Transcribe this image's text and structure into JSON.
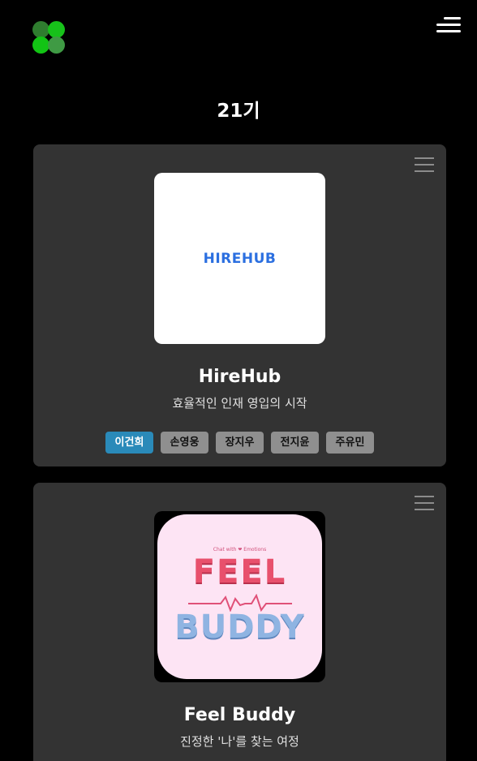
{
  "header": {
    "logo_icon": "clover-logo-icon",
    "menu_icon": "hamburger-menu-icon"
  },
  "page_title": "21기",
  "projects": [
    {
      "name": "HireHub",
      "thumbnail_text": "HIREHUB",
      "description": "효율적인 인재 영입의 시작",
      "members": [
        {
          "name": "이건희",
          "active": true
        },
        {
          "name": "손영웅",
          "active": false
        },
        {
          "name": "장지우",
          "active": false
        },
        {
          "name": "전지윤",
          "active": false
        },
        {
          "name": "주유민",
          "active": false
        }
      ]
    },
    {
      "name": "Feel Buddy",
      "thumbnail_tagline": "Chat with ❤ Emotions",
      "thumbnail_word1": "FEEL",
      "thumbnail_word2": "BUDDY",
      "description": "진정한 '나'를 찾는 여정"
    }
  ],
  "colors": {
    "background": "#000000",
    "card": "#333333",
    "active_member": "#2a8ab9",
    "inactive_member": "#8f8f8f",
    "hirehub_brand": "#2b6fe0"
  }
}
